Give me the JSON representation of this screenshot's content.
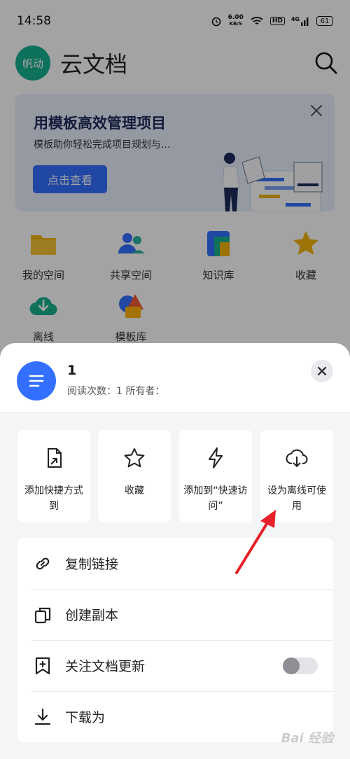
{
  "status_bar": {
    "time": "14:58",
    "network_speed_value": "6.00",
    "network_speed_unit": "KB/S",
    "hd_label": "HD",
    "signal_label": "4G",
    "battery_level": "61"
  },
  "header": {
    "avatar_text": "帆动",
    "title": "云文档"
  },
  "banner": {
    "title": "用模板高效管理项目",
    "subtitle": "模板助你轻松完成项目规划与...",
    "button_label": "点击查看"
  },
  "quick_access": [
    {
      "label": "我的空间",
      "icon": "folder-icon"
    },
    {
      "label": "共享空间",
      "icon": "shared-people-icon"
    },
    {
      "label": "知识库",
      "icon": "knowledge-base-icon"
    },
    {
      "label": "收藏",
      "icon": "star-icon"
    },
    {
      "label": "离线",
      "icon": "offline-cloud-icon"
    },
    {
      "label": "模板库",
      "icon": "template-icon"
    }
  ],
  "sheet": {
    "doc_title": "1",
    "doc_meta": "阅读次数：1  所有者：",
    "actions": [
      {
        "label": "添加快捷方式到",
        "icon": "shortcut-icon"
      },
      {
        "label": "收藏",
        "icon": "star-outline-icon"
      },
      {
        "label": "添加到“快速访问”",
        "icon": "lightning-icon"
      },
      {
        "label": "设为离线可使用",
        "icon": "cloud-download-icon"
      }
    ],
    "menu": [
      {
        "label": "复制链接",
        "icon": "link-icon"
      },
      {
        "label": "创建副本",
        "icon": "copy-icon"
      },
      {
        "label": "关注文档更新",
        "icon": "bookmark-plus-icon",
        "toggle": false
      },
      {
        "label": "下载为",
        "icon": "download-icon"
      }
    ]
  },
  "watermark": "Bai 经验",
  "colors": {
    "accent": "#3370ff",
    "avatar": "#16b18f",
    "banner_bg": "#e9f0fd",
    "sheet_bg": "#f4f5f7",
    "arrow": "#e8202a"
  }
}
